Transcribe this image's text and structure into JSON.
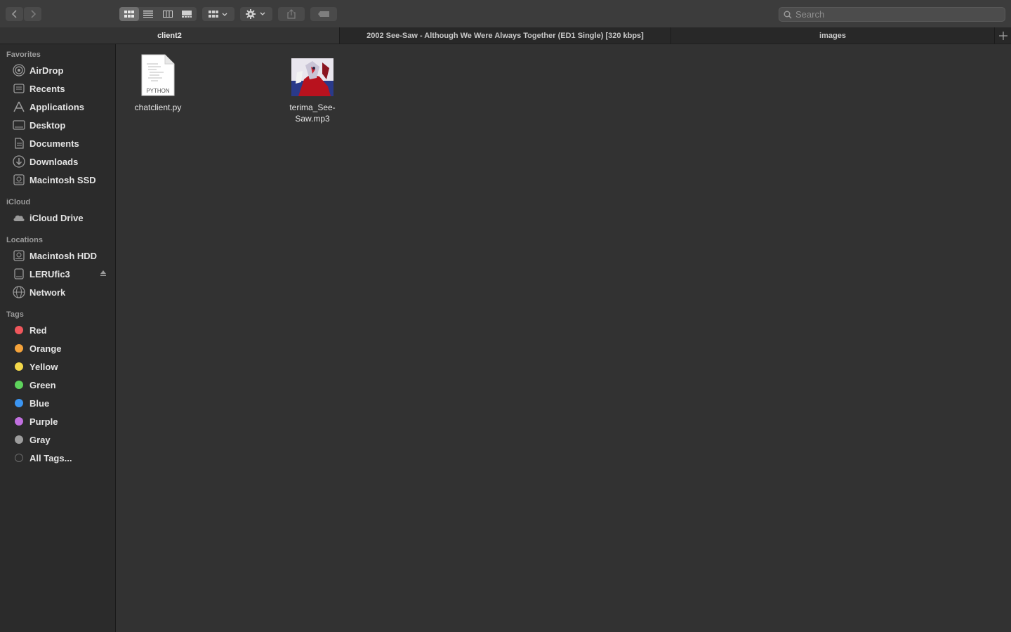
{
  "toolbar": {
    "view_modes": [
      "icon-view",
      "list-view",
      "column-view",
      "gallery-view"
    ],
    "active_view": "icon-view",
    "search_placeholder": "Search"
  },
  "tabs": [
    {
      "label": "client2",
      "active": true
    },
    {
      "label": "2002 See-Saw - Although We Were Always Together (ED1 Single) [320 kbps]",
      "active": false
    },
    {
      "label": "images",
      "active": false
    }
  ],
  "sidebar": {
    "favorites_title": "Favorites",
    "favorites": [
      {
        "label": "AirDrop",
        "icon": "airdrop-icon"
      },
      {
        "label": "Recents",
        "icon": "recents-icon"
      },
      {
        "label": "Applications",
        "icon": "applications-icon"
      },
      {
        "label": "Desktop",
        "icon": "desktop-icon"
      },
      {
        "label": "Documents",
        "icon": "documents-icon"
      },
      {
        "label": "Downloads",
        "icon": "downloads-icon"
      },
      {
        "label": "Macintosh SSD",
        "icon": "disk-icon"
      }
    ],
    "icloud_title": "iCloud",
    "icloud": [
      {
        "label": "iCloud Drive",
        "icon": "cloud-icon"
      }
    ],
    "locations_title": "Locations",
    "locations": [
      {
        "label": "Macintosh HDD",
        "icon": "disk-icon"
      },
      {
        "label": "LERUfic3",
        "icon": "external-drive-icon",
        "ejectable": true
      },
      {
        "label": "Network",
        "icon": "network-icon"
      }
    ],
    "tags_title": "Tags",
    "tags": [
      {
        "label": "Red",
        "color": "#f0575c"
      },
      {
        "label": "Orange",
        "color": "#f5a33b"
      },
      {
        "label": "Yellow",
        "color": "#f4d84a"
      },
      {
        "label": "Green",
        "color": "#5ed35c"
      },
      {
        "label": "Blue",
        "color": "#3b95f2"
      },
      {
        "label": "Purple",
        "color": "#c170e0"
      },
      {
        "label": "Gray",
        "color": "#9d9d9d"
      },
      {
        "label": "All Tags...",
        "color": "#6a6a6a"
      }
    ]
  },
  "files": [
    {
      "name": "chatclient.py",
      "icon": "python-file-icon",
      "badge": "PYTHON"
    },
    {
      "name": "terima_See-Saw.mp3",
      "icon": "mp3-artwork-icon"
    }
  ]
}
